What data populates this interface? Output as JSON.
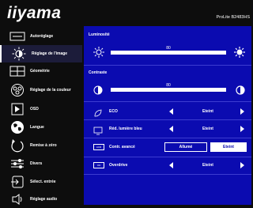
{
  "header": {
    "logo": "iiyama",
    "model": "ProLite B2483HS"
  },
  "sidebar": {
    "items": [
      {
        "label": "Autoréglage",
        "icon": "auto-adjust-icon",
        "active": false
      },
      {
        "label": "Réglage de l'image",
        "icon": "image-adjust-icon",
        "active": true
      },
      {
        "label": "Géométrie",
        "icon": "geometry-icon",
        "active": false
      },
      {
        "label": "Réglage de la couleur",
        "icon": "color-adjust-icon",
        "active": false
      },
      {
        "label": "OSD",
        "icon": "osd-icon",
        "active": false
      },
      {
        "label": "Langue",
        "icon": "language-globe-icon",
        "active": false
      },
      {
        "label": "Remise à zéro",
        "icon": "reset-icon",
        "active": false
      },
      {
        "label": "Divers",
        "icon": "misc-sliders-icon",
        "active": false
      },
      {
        "label": "Sélect. entrée",
        "icon": "input-select-icon",
        "active": false
      },
      {
        "label": "Réglage audio",
        "icon": "speaker-icon",
        "active": false
      }
    ]
  },
  "panel": {
    "brightness": {
      "label": "Luminosité",
      "value": "80",
      "level": 80
    },
    "contrast": {
      "label": "Contraste",
      "value": "80",
      "level": 80
    },
    "eco": {
      "label": "ECO",
      "value": "Eteint"
    },
    "blue_light": {
      "label": "Réd. lumière bleu",
      "value": "Eteint"
    },
    "adv_contrast": {
      "label": "Contr. avancé",
      "option_on": "Allumé",
      "option_off": "Eteint",
      "selected": "Eteint",
      "icon_text": "ACR"
    },
    "overdrive": {
      "label": "Overdrive",
      "value": "Eteint",
      "icon_text": "OD"
    }
  },
  "colors": {
    "panel_blue": "#0b0bb0",
    "background": "#0d0d0d",
    "text": "#ffffff"
  }
}
